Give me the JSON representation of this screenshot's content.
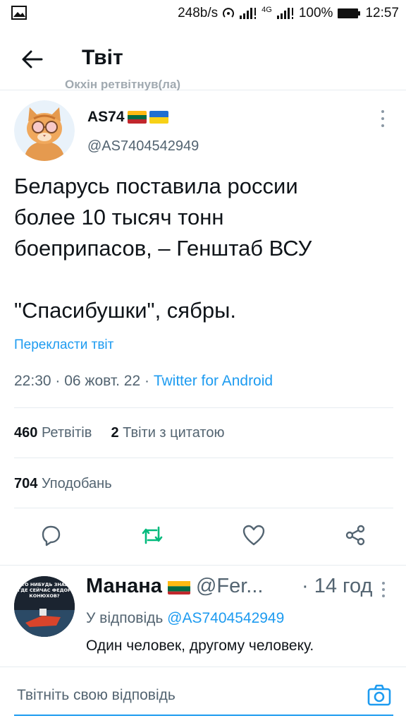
{
  "status_bar": {
    "speed": "248b/s",
    "network": "4G",
    "battery": "100%",
    "time": "12:57"
  },
  "header": {
    "title": "Твіт",
    "retweet_note": "Окхін ретвітнув(ла)"
  },
  "tweet": {
    "author_name": "AS74",
    "author_flags": [
      "lithuania-flag",
      "ukraine-flag"
    ],
    "author_handle": "@AS7404542949",
    "text_lines": [
      "Беларусь поставила россии",
      "более 10 тысяч тонн",
      "боеприпасов, – Генштаб ВСУ",
      "",
      "\"Спасибушки\", сябры."
    ],
    "translate_label": "Перекласти твіт",
    "time": "22:30",
    "date": "06 жовт. 22",
    "source": "Twitter for Android",
    "retweets_count": "460",
    "retweets_label": "Ретвітів",
    "quotes_count": "2",
    "quotes_label": "Твіти з цитатою",
    "likes_count": "704",
    "likes_label": "Уподобань"
  },
  "reply": {
    "name": "Манана",
    "flag": "lithuania-flag",
    "handle": "@Fer...",
    "time": "· 14 год",
    "reply_to_label": "У відповідь",
    "reply_to_handle": "@AS7404542949",
    "text": "Один человек, другому человеку.",
    "avatar_caption": "КТО НИБУДЬ ЗНАЕТ ГДЕ СЕЙЧАС ФЕДОР КОНЮХОВ?"
  },
  "composer": {
    "placeholder": "Твітніть свою відповідь"
  },
  "colors": {
    "accent": "#1d9bf0",
    "retweet_green": "#00ba7c",
    "secondary_text": "#536471",
    "divider": "#e6ecf0"
  }
}
